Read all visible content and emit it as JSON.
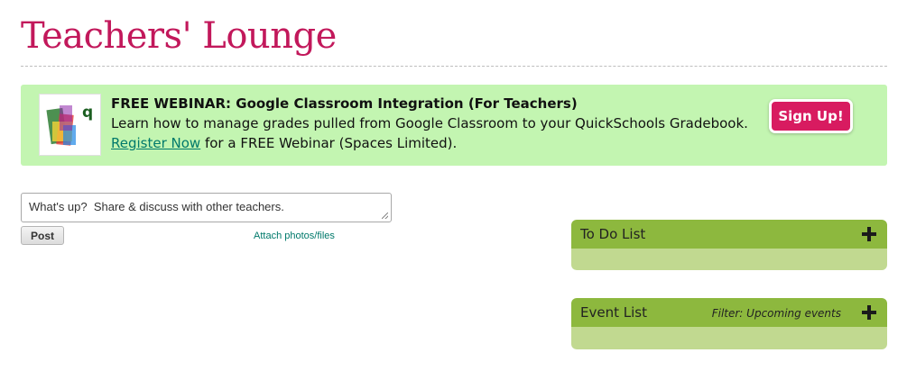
{
  "page": {
    "title": "Teachers' Lounge"
  },
  "banner": {
    "heading": "FREE WEBINAR: Google Classroom Integration (For Teachers)",
    "description": "Learn how to manage grades pulled from Google Classroom to your QuickSchools Gradebook.",
    "link_label": "Register Now",
    "cta_suffix": " for a FREE Webinar (Spaces Limited).",
    "signup_label": "Sign Up!",
    "logo_letter": "q",
    "background": "#c3f5b1",
    "accent": "#d81b60"
  },
  "composer": {
    "placeholder": "What's up?  Share & discuss with other teachers.",
    "post_label": "Post",
    "attach_label": "Attach photos/files"
  },
  "panels": {
    "todo": {
      "title": "To Do List",
      "header_color": "#8db83e",
      "body_color": "#c1d990"
    },
    "events": {
      "title": "Event List",
      "filter": "Filter: Upcoming events"
    }
  }
}
